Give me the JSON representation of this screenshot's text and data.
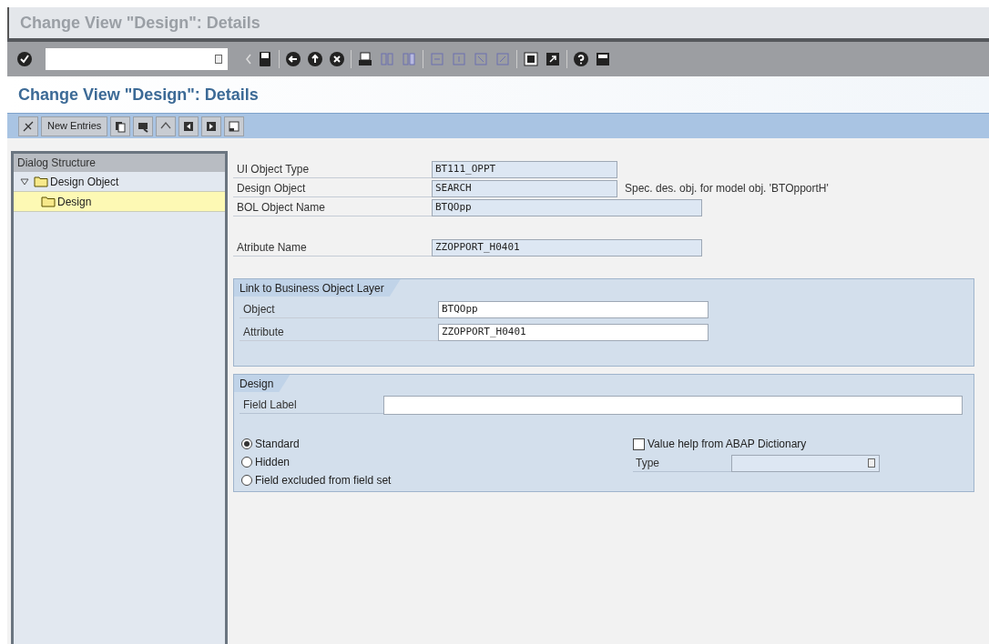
{
  "window": {
    "title": "Change View \"Design\": Details"
  },
  "screen_title": "Change View \"Design\": Details",
  "app_toolbar": {
    "new_entries": "New Entries"
  },
  "dialog_structure": {
    "title": "Dialog Structure",
    "items": [
      {
        "label": "Design Object",
        "expanded": true,
        "selected": false,
        "children": [
          {
            "label": "Design",
            "selected": true
          }
        ]
      }
    ]
  },
  "fields": [
    {
      "label": "UI Object Type",
      "value": "BT111_OPPT",
      "kind": "short"
    },
    {
      "label": "Design Object",
      "value": "SEARCH",
      "kind": "short",
      "description": "Spec. des. obj. for model obj. 'BTOpportH'"
    },
    {
      "label": "BOL Object Name",
      "value": "BTQOpp",
      "kind": "long"
    }
  ],
  "attribute_field": {
    "label": "Atribute Name",
    "value": "ZZOPPORT_H0401"
  },
  "link_group": {
    "title": "Link to Business Object Layer",
    "fields": [
      {
        "label": "Object",
        "value": "BTQOpp"
      },
      {
        "label": "Attribute",
        "value": "ZZOPPORT_H0401"
      }
    ]
  },
  "design_group": {
    "title": "Design",
    "field_label": {
      "label": "Field Label"
    },
    "options": [
      {
        "label": "Standard",
        "selected": true
      },
      {
        "label": "Hidden",
        "selected": false
      },
      {
        "label": "Field excluded from field set",
        "selected": false
      }
    ],
    "value_help": {
      "label": "Value help from ABAP Dictionary",
      "checked": false
    },
    "type": {
      "label": "Type"
    }
  }
}
